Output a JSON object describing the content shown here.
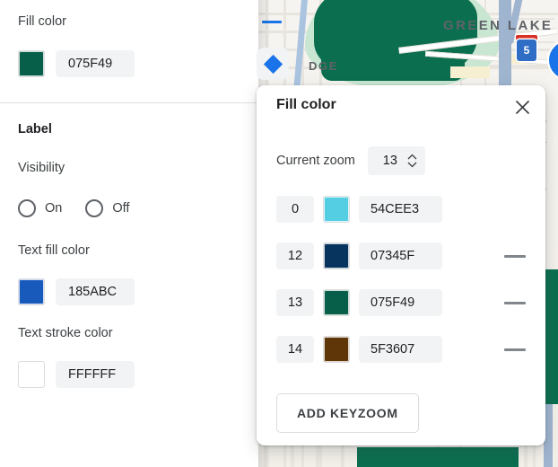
{
  "left_panel": {
    "fill_color": {
      "label": "Fill color",
      "swatch_color": "#075F49",
      "hex_value": "075F49"
    },
    "collapse_icon": "minus-icon",
    "keyzoom_toggle_icon": "diamond-icon",
    "label_section": {
      "title": "Label",
      "visibility_label": "Visibility",
      "visibility_options": [
        {
          "label": "On",
          "selected": false
        },
        {
          "label": "Off",
          "selected": false
        }
      ],
      "text_fill_color": {
        "label": "Text fill color",
        "swatch_color": "#185ABC",
        "hex_value": "185ABC"
      },
      "text_stroke_color": {
        "label": "Text stroke color",
        "swatch_color": "#FFFFFF",
        "hex_value": "FFFFFF"
      }
    }
  },
  "dialog": {
    "title": "Fill color",
    "close_icon": "close-icon",
    "current_zoom": {
      "label": "Current zoom",
      "value": "13",
      "increment_icon": "chevron-up-icon",
      "decrement_icon": "chevron-down-icon"
    },
    "keyzoom_rows": [
      {
        "zoom": "0",
        "color": "#54CEE3",
        "hex": "54CEE3",
        "removable": false
      },
      {
        "zoom": "12",
        "color": "#07345F",
        "hex": "07345F",
        "removable": true
      },
      {
        "zoom": "13",
        "color": "#075F49",
        "hex": "075F49",
        "removable": true
      },
      {
        "zoom": "14",
        "color": "#5F3607",
        "hex": "5F3607",
        "removable": true
      }
    ],
    "add_button": "ADD KEYZOOM"
  },
  "map": {
    "labels": [
      {
        "text": "GREEN LAKE",
        "size": "large"
      },
      {
        "text": "DGE",
        "size": "small"
      }
    ],
    "highway_shield": "5",
    "pin_color": "#1A73E8"
  },
  "theme": {
    "accent": "#1A73E8",
    "field_bg": "#F1F3F4",
    "text": "#202124",
    "muted_text": "#3C4043"
  }
}
